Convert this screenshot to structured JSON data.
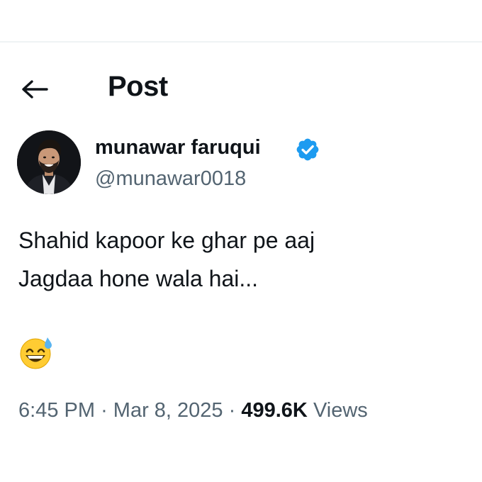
{
  "header": {
    "title": "Post"
  },
  "author": {
    "display_name": "munawar faruqui",
    "handle": "@munawar0018",
    "verified": true,
    "verified_color": "#1d9bf0"
  },
  "post": {
    "lines": [
      "Shahid kapoor ke ghar pe aaj",
      "Jagdaa hone wala hai..."
    ],
    "emoji": "grinning-face-with-sweat-icon"
  },
  "meta": {
    "time": "6:45 PM",
    "separator": "·",
    "date": "Mar 8, 2025",
    "views_count": "499.6K",
    "views_label": "Views"
  }
}
